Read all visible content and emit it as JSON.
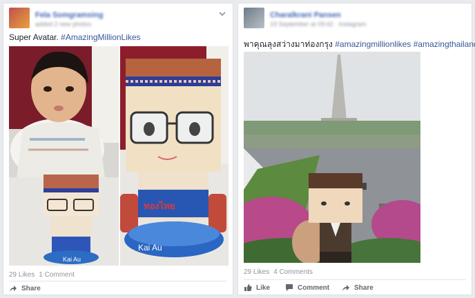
{
  "post1": {
    "author": "Fela Somgramsing",
    "meta": "added 2 new photos",
    "caption_text": "Super Avatar. ",
    "caption_tag": "#AmazingMillionLikes",
    "photo2_badge": "ทองไทย",
    "photo2_name": "Kai Au",
    "photo1_name": "Kai Au",
    "likes": "29 Likes",
    "comments": "1 Comment",
    "share_label": "Share"
  },
  "post2": {
    "author": "Charalkrani Pansen",
    "meta": "19 September at 09:42 · Instagram",
    "caption_text": "พาคุณลุงสว่างมาท่องกรุง ",
    "caption_tag1": "#amazingmillionlikes",
    "caption_tag2": "#amazingthailand",
    "likes": "29 Likes",
    "comments": "4 Comments",
    "like_label": "Like",
    "comment_label": "Comment",
    "share_label": "Share"
  },
  "colors": {
    "link": "#365899",
    "name": "#4267b2",
    "muted": "#90949c",
    "action": "#616770"
  }
}
